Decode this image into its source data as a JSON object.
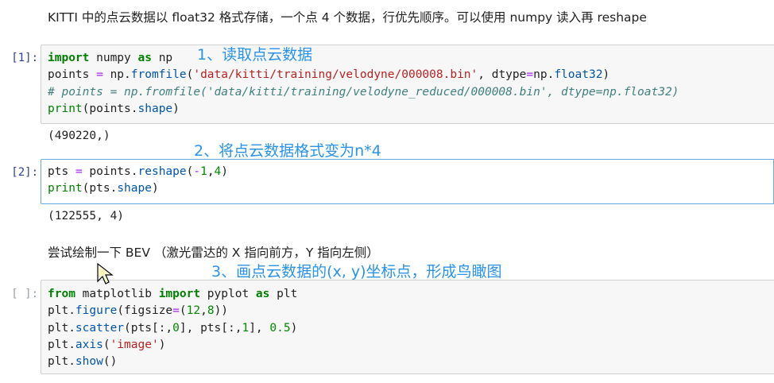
{
  "intro_text": "KITTI 中的点云数据以 float32 格式存储，一个点 4 个数据，行优先顺序。可以使用 numpy 读入再 reshape",
  "cell1": {
    "prompt": "[1]:",
    "code": {
      "l1a": "import",
      "l1b": " numpy ",
      "l1c": "as",
      "l1d": " np",
      "l2a": "points ",
      "l2b": "=",
      "l2c": " np.",
      "l2d": "fromfile",
      "l2e": "(",
      "l2f": "'data/kitti/training/velodyne/000008.bin'",
      "l2g": ", dtype",
      "l2h": "=",
      "l2i": "np.",
      "l2j": "float32",
      "l2k": ")",
      "l3": "# points = np.fromfile('data/kitti/training/velodyne_reduced/000008.bin', dtype=np.float32)",
      "l4a": "print",
      "l4b": "(points.",
      "l4c": "shape",
      "l4d": ")"
    },
    "output": "(490220,)"
  },
  "cell2": {
    "prompt": "[2]:",
    "code": {
      "l1a": "pts ",
      "l1b": "=",
      "l1c": " points.",
      "l1d": "reshape",
      "l1e": "(",
      "l1f": "-",
      "l1g": "1",
      "l1h": ",",
      "l1i": "4",
      "l1j": ")",
      "l2a": "print",
      "l2b": "(pts.",
      "l2c": "shape",
      "l2d": ")"
    },
    "output": "(122555, 4)"
  },
  "markdown2": "尝试绘制一下 BEV （激光雷达的 X 指向前方，Y 指向左侧）",
  "cell3": {
    "prompt": "[ ]:",
    "code": {
      "l1a": "from",
      "l1b": " matplotlib ",
      "l1c": "import",
      "l1d": " pyplot ",
      "l1e": "as",
      "l1f": " plt",
      "l2a": "plt.",
      "l2b": "figure",
      "l2c": "(figsize",
      "l2d": "=",
      "l2e": "(",
      "l2f": "12",
      "l2g": ",",
      "l2h": "8",
      "l2i": "))",
      "l3a": "plt.",
      "l3b": "scatter",
      "l3c": "(pts[:,",
      "l3d": "0",
      "l3e": "], pts[:,",
      "l3f": "1",
      "l3g": "], ",
      "l3h": "0.5",
      "l3i": ")",
      "l4a": "plt.",
      "l4b": "axis",
      "l4c": "(",
      "l4d": "'image'",
      "l4e": ")",
      "l5a": "plt.",
      "l5b": "show",
      "l5c": "()"
    }
  },
  "annotations": {
    "a1": "1、读取点云数据",
    "a2": "2、将点云数据格式变为n*4",
    "a3": "3、画点云数据的(x, y)坐标点，形成鸟瞰图"
  },
  "colors": {
    "prompt": "#303f9f",
    "annotation": "#2a93e8",
    "keyword": "#008000",
    "string": "#ba2121",
    "comment": "#408080",
    "selected_border": "#66a8e0"
  }
}
